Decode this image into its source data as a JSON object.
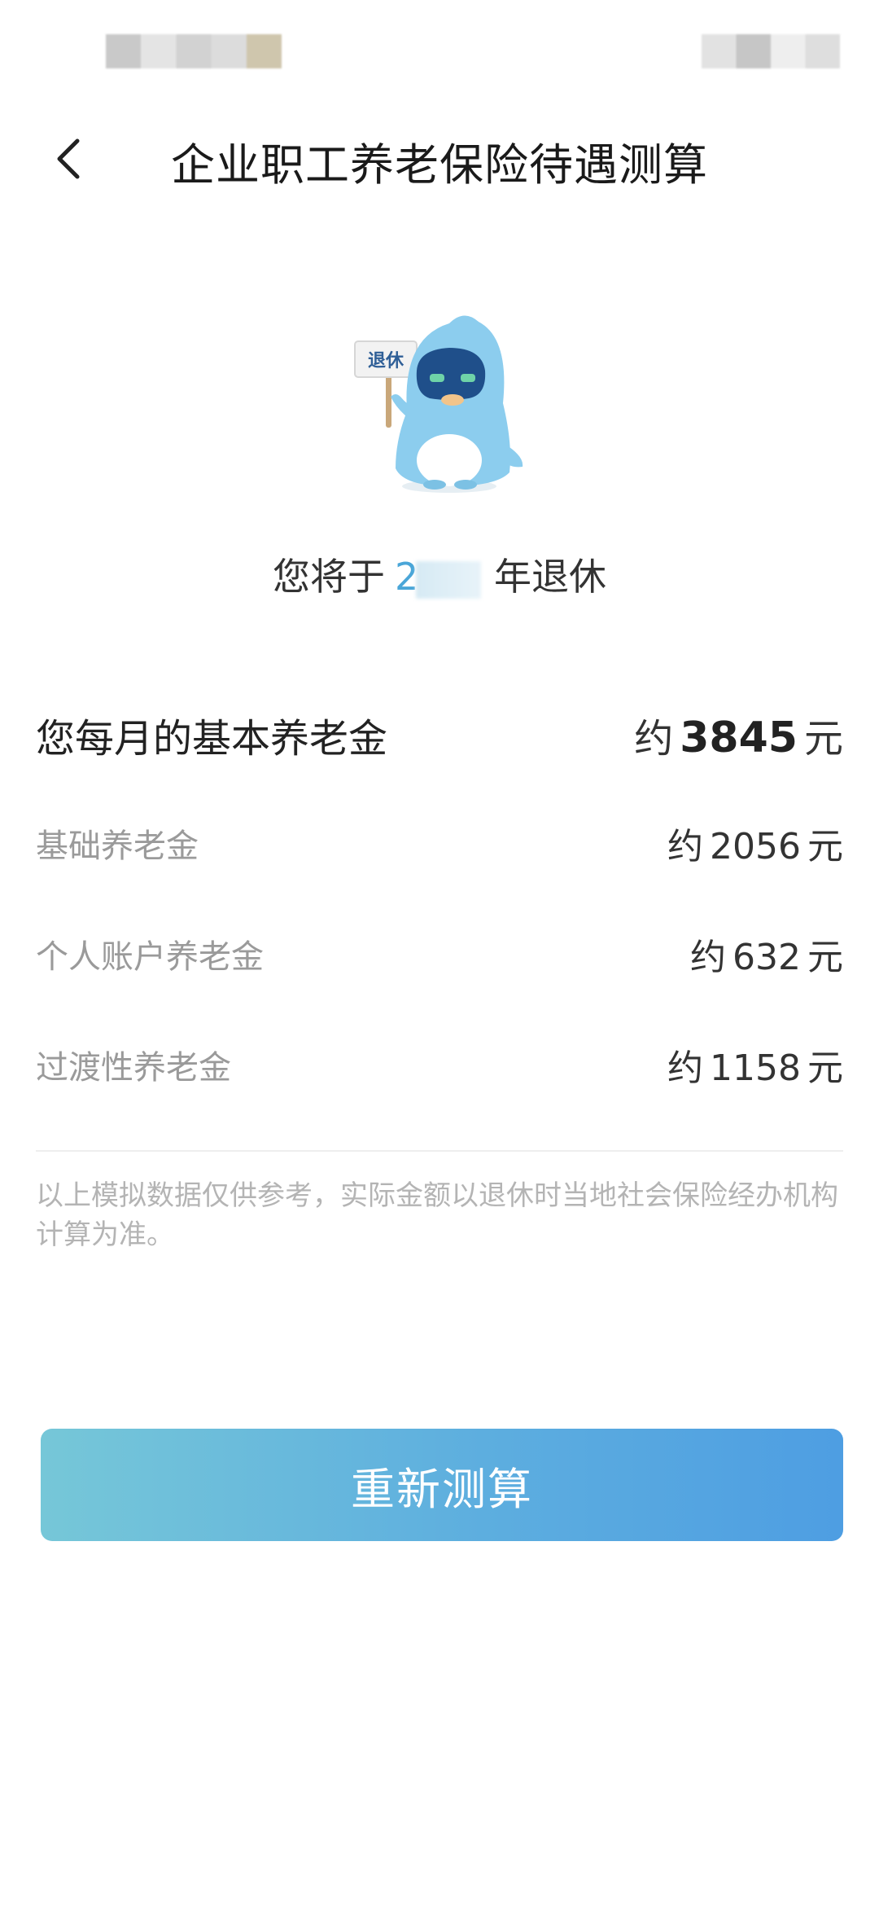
{
  "header": {
    "title": "企业职工养老保险待遇测算"
  },
  "mascot": {
    "sign_text": "退休"
  },
  "retirement": {
    "prefix": "您将于",
    "year_visible": "2",
    "suffix": "年退休"
  },
  "monthly": {
    "label": "您每月的基本养老金",
    "approx": "约",
    "amount": "3845",
    "unit": "元"
  },
  "breakdown": [
    {
      "label": "基础养老金",
      "approx": "约",
      "amount": "2056",
      "unit": "元"
    },
    {
      "label": "个人账户养老金",
      "approx": "约",
      "amount": "632",
      "unit": "元"
    },
    {
      "label": "过渡性养老金",
      "approx": "约",
      "amount": "1158",
      "unit": "元"
    }
  ],
  "disclaimer": "以上模拟数据仅供参考，实际金额以退休时当地社会保险经办机构计算为准。",
  "actions": {
    "recalculate_label": "重新测算"
  },
  "colors": {
    "accent": "#4aa6d8",
    "button_start": "#76c7d8",
    "button_end": "#4e9ee2"
  }
}
